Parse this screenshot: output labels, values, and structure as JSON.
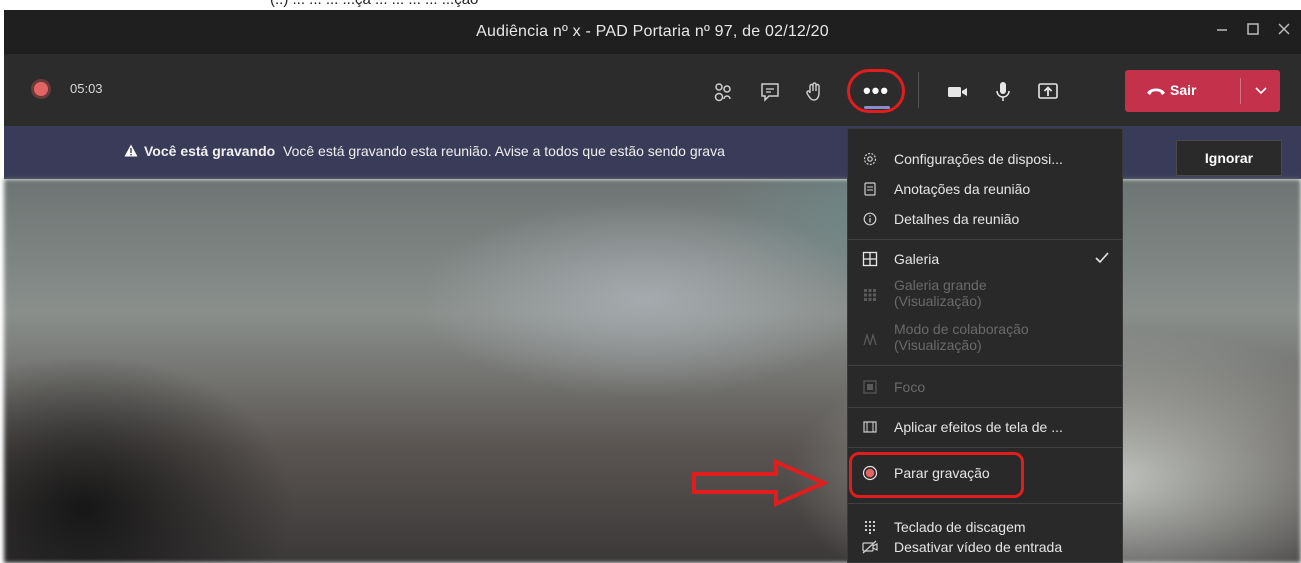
{
  "caption": {
    "text": "(..) ... ... ... ...çã ... ... ... ... ...ção"
  },
  "window": {
    "title": "Audiência nº x - PAD Portaria nº 97, de 02/12/20"
  },
  "toolbar": {
    "timer": "05:03",
    "leave_label": "Sair"
  },
  "banner": {
    "bold_label": "Você está gravando",
    "message": "Você está gravando esta reunião. Avise a todos que estão sendo grava",
    "ignore_label": "Ignorar"
  },
  "menu": {
    "items": [
      {
        "label": "Configurações de disposi...",
        "icon": "settings-icon"
      },
      {
        "label": "Anotações da reunião",
        "icon": "notes-icon"
      },
      {
        "label": "Detalhes da reunião",
        "icon": "info-icon"
      },
      {
        "label": "Galeria",
        "icon": "grid-icon",
        "checked": true
      },
      {
        "label": "Galeria grande",
        "label2": "(Visualização)",
        "icon": "large-grid-icon",
        "disabled": true
      },
      {
        "label": "Modo de colaboração",
        "label2": "(Visualização)",
        "icon": "together-mode-icon",
        "disabled": true
      },
      {
        "label": "Foco",
        "icon": "focus-icon",
        "disabled": true
      },
      {
        "label": "Aplicar efeitos de tela de ...",
        "icon": "background-effects-icon"
      },
      {
        "label": "Parar gravação",
        "icon": "record-stop-icon"
      },
      {
        "label": "Teclado de discagem",
        "icon": "dialpad-icon"
      },
      {
        "label": "Desativar vídeo de entrada",
        "icon": "video-off-icon"
      }
    ]
  },
  "colors": {
    "leave": "#c4314b",
    "annotation": "#e11d1d",
    "banner": "#3a3b58",
    "record": "#e36464"
  }
}
